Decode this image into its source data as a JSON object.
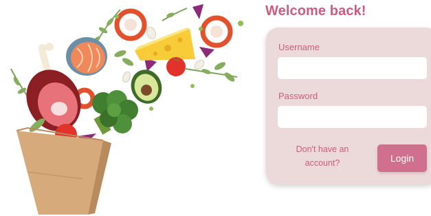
{
  "header": {
    "title": "Welcome back!"
  },
  "login_form": {
    "username_label": "Username",
    "username_value": "",
    "password_label": "Password",
    "password_value": "",
    "signup_prompt": "Don't have an account?",
    "login_label": "Login"
  },
  "colors": {
    "accent": "#cc5c7e",
    "card_background": "#ecd9da",
    "button": "#d0708e"
  },
  "illustration": {
    "icon": "grocery-bag-icon",
    "items": [
      "meat",
      "salmon-steak",
      "bell-pepper-slice",
      "cheese",
      "tomato",
      "avocado",
      "broccoli",
      "chicken-drumstick",
      "herbs",
      "garlic",
      "red-onion"
    ]
  }
}
